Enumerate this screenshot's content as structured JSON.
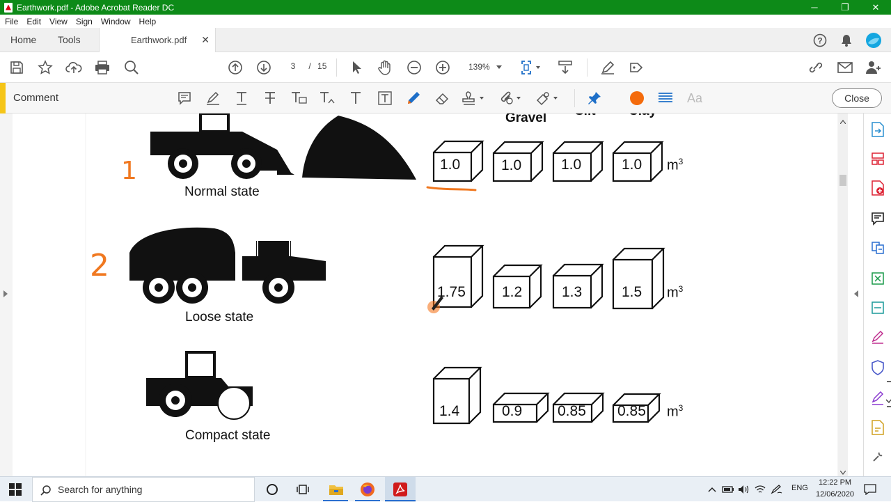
{
  "window": {
    "title": "Earthwork.pdf - Adobe Acrobat Reader DC",
    "minimize": "─",
    "maximize": "❐",
    "close": "✕"
  },
  "menu": [
    "File",
    "Edit",
    "View",
    "Sign",
    "Window",
    "Help"
  ],
  "tabs": {
    "home": "Home",
    "tools": "Tools",
    "document": "Earthwork.pdf",
    "close": "✕"
  },
  "nav": {
    "current_page": "3",
    "page_sep": "/",
    "total_pages": "15",
    "zoom": "139%"
  },
  "comment": {
    "label": "Comment",
    "close_label": "Close",
    "color": "#f46b0c",
    "text_size_label": "Aa"
  },
  "figure": {
    "column_header_partial": {
      "gravel": "Gravel",
      "silt": "Silt",
      "clay": "Clay"
    },
    "rows": [
      {
        "caption": "Normal state",
        "handwritten": "1",
        "values": [
          "1.0",
          "1.0",
          "1.0",
          "1.0"
        ],
        "unit": "m",
        "exp": "3"
      },
      {
        "caption": "Loose state",
        "handwritten": "2",
        "values": [
          "1.75",
          "1.2",
          "1.3",
          "1.5"
        ],
        "unit": "m",
        "exp": "3"
      },
      {
        "caption": "Compact state",
        "handwritten": "",
        "values": [
          "1.4",
          "0.9",
          "0.85",
          "0.85"
        ],
        "unit": "m",
        "exp": "3"
      }
    ]
  },
  "taskbar": {
    "search_placeholder": "Search for anything",
    "lang": "ENG",
    "time": "12:22 PM",
    "date": "12/06/2020"
  }
}
